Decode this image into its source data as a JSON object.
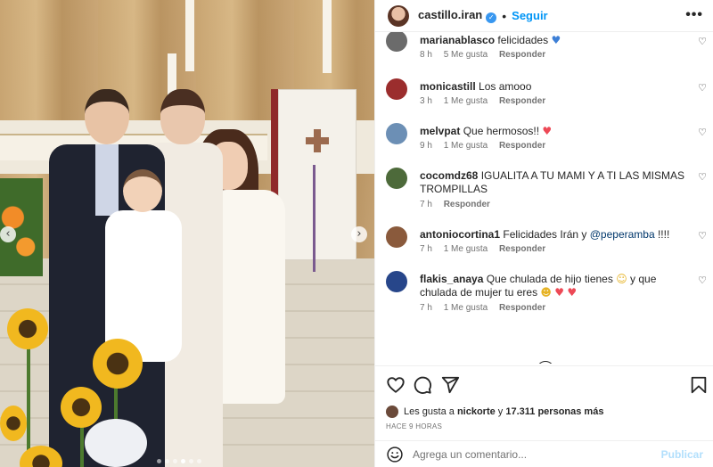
{
  "post": {
    "username": "castillo.iran",
    "verified": true,
    "separator": "•",
    "follow_label": "Seguir",
    "more_label": "•••"
  },
  "photo": {
    "description_icon": "photo-carousel",
    "prev_arrow": "‹",
    "next_arrow": "›",
    "dots_count": 6,
    "active_dot": 3
  },
  "comments": [
    {
      "username": "marianablasco",
      "text": "felicidades",
      "emoji": "blue-heart",
      "time": "8 h",
      "likes": "5 Me gusta",
      "reply": "Responder",
      "avatar_color": "#6b6b6b"
    },
    {
      "username": "monicastill",
      "text": "Los amooo",
      "time": "3 h",
      "likes": "1 Me gusta",
      "reply": "Responder",
      "avatar_color": "#9b2d2d"
    },
    {
      "username": "melvpat",
      "text": "Que hermosos!!",
      "emoji": "red-heart",
      "time": "9 h",
      "likes": "1 Me gusta",
      "reply": "Responder",
      "avatar_color": "#6c8fb5"
    },
    {
      "username": "cocomdz68",
      "text": "IGUALITA A TU MAMI Y A TI LAS MISMAS TROMPILLAS",
      "time": "7 h",
      "likes": "",
      "reply": "Responder",
      "avatar_color": "#4d6a3a"
    },
    {
      "username": "antoniocortina1",
      "text": "Felicidades Irán y",
      "mention": "@peperamba",
      "suffix": " !!!!",
      "time": "7 h",
      "likes": "1 Me gusta",
      "reply": "Responder",
      "avatar_color": "#8a5a3c"
    },
    {
      "username": "flakis_anaya",
      "text": "Que chulada de hijo tienes",
      "text2": "y que chulada de mujer tu eres",
      "time": "7 h",
      "likes": "1 Me gusta",
      "reply": "Responder",
      "avatar_color": "#27468a"
    }
  ],
  "actions": {
    "like_icon": "heart-outline-icon",
    "comment_icon": "comment-icon",
    "share_icon": "send-icon",
    "save_icon": "bookmark-icon"
  },
  "likes": {
    "prefix": "Les gusta a",
    "user": "nickorte",
    "middle": "y",
    "count": "17.311 personas más"
  },
  "time_ago": "HACE 9 HORAS",
  "add_comment": {
    "placeholder": "Agrega un comentario...",
    "publish_label": "Publicar"
  },
  "colors": {
    "link_blue": "#0095f6",
    "heart_red": "#ed4956",
    "muted": "#737373"
  }
}
